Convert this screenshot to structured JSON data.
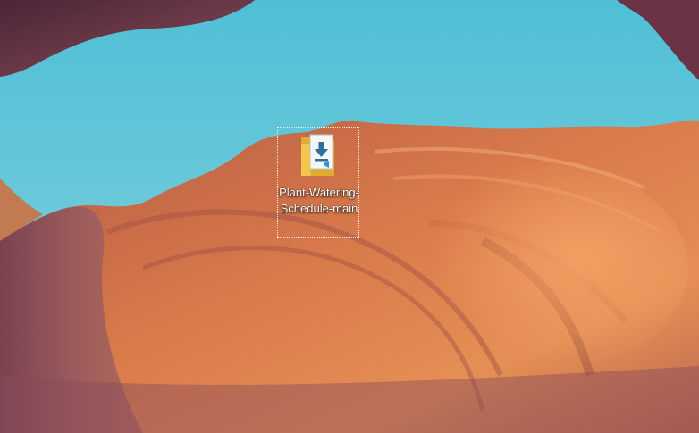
{
  "desktop": {
    "wallpaper": "antelope-canyon",
    "icons": [
      {
        "label": "Plant-Watering-Schedule-main",
        "icon": "folder-download-icon",
        "selected": true
      }
    ]
  },
  "colors": {
    "sky": "#5ac3d9",
    "rock_light": "#e8874f",
    "rock_dark": "#5a2e3a",
    "folder": "#f3c64e",
    "download_arrow": "#2f6f9e"
  }
}
